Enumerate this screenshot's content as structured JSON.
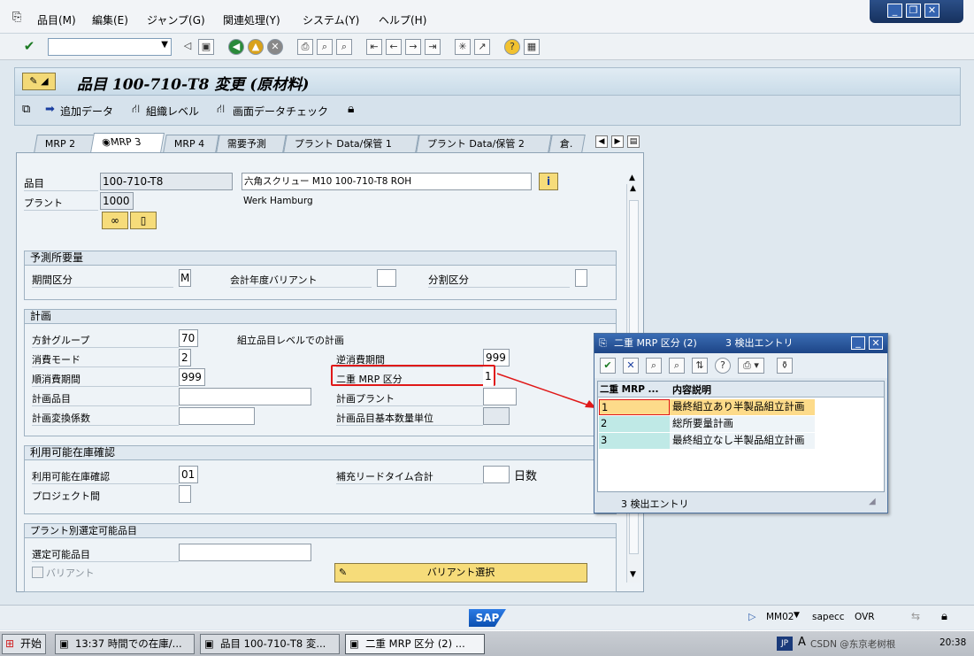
{
  "menubar": {
    "items": [
      "品目(M)",
      "編集(E)",
      "ジャンプ(G)",
      "関連処理(Y)",
      "システム(Y)",
      "ヘルプ(H)"
    ]
  },
  "toolbar": {
    "command_value": ""
  },
  "screen": {
    "title": "品目 100-710-T8 変更 (原材料)"
  },
  "appbar": {
    "additional_data": "追加データ",
    "org_levels": "組織レベル",
    "check_screen_data": "画面データチェック"
  },
  "tabs": [
    "MRP 2",
    "MRP 3",
    "MRP 4",
    "需要予測",
    "プラント Data/保管 1",
    "プラント Data/保管 2",
    "倉."
  ],
  "header": {
    "material_label": "品目",
    "material_value": "100-710-T8",
    "material_desc": "六角スクリュー M10 100-710-T8 ROH",
    "plant_label": "プラント",
    "plant_value": "1000",
    "plant_name": "Werk Hamburg"
  },
  "forecast": {
    "title": "予測所要量",
    "period_label": "期間区分",
    "period_value": "M",
    "fiscal_variant_label": "会計年度バリアント",
    "split_label": "分割区分"
  },
  "planning": {
    "title": "計画",
    "strategy_group_label": "方針グループ",
    "strategy_group_value": "70",
    "strategy_note": "組立品目レベルでの計画",
    "consumption_mode_label": "消費モード",
    "consumption_mode_value": "2",
    "bwd_period_label": "逆消費期間",
    "bwd_period_value": "999",
    "fwd_period_label": "順消費期間",
    "fwd_period_value": "999",
    "mixed_mrp_label": "二重 MRP 区分",
    "mixed_mrp_value": "1",
    "planning_material_label": "計画品目",
    "planning_plant_label": "計画プラント",
    "conv_factor_label": "計画変換係数",
    "base_unit_label": "計画品目基本数量単位"
  },
  "availability": {
    "title": "利用可能在庫確認",
    "check_label": "利用可能在庫確認",
    "check_value": "01",
    "replenish_label": "補充リードタイム合計",
    "days_label": "日数",
    "cross_project_label": "プロジェクト間"
  },
  "configurable": {
    "title": "プラント別選定可能品目",
    "material_label": "選定可能品目",
    "variant_label": "バリアント",
    "variant_button": "バリアント選択"
  },
  "popup": {
    "title": "二重 MRP 区分 (2)",
    "hits": "3 検出エントリ",
    "col1": "二重 MRP ...",
    "col2": "内容説明",
    "rows": [
      {
        "key": "1",
        "text": "最終組立あり半製品組立計画"
      },
      {
        "key": "2",
        "text": "総所要量計画"
      },
      {
        "key": "3",
        "text": "最終組立なし半製品組立計画"
      }
    ],
    "status": "3 検出エントリ"
  },
  "statusbar": {
    "logo": "SAP",
    "tcode": "MM02",
    "server": "sapecc",
    "mode": "OVR"
  },
  "taskbar": {
    "start": "开始",
    "tasks": [
      "13:37 時間での在庫/...",
      "品目 100-710-T8 変...",
      "二重 MRP 区分 (2) ..."
    ],
    "lang": "JP",
    "time": "20:38",
    "watermark": "CSDN @东京老树根"
  },
  "colors": {
    "highlight_red": "#e01818",
    "row_selected": "#fddb8a",
    "row_key": "#bfe9e6"
  }
}
